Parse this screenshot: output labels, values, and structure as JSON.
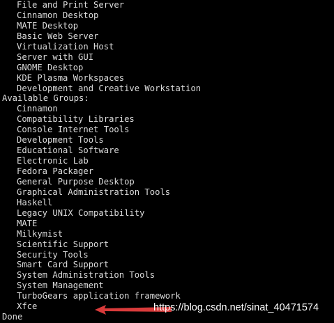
{
  "terminal": {
    "environment_groups_tail": [
      "File and Print Server",
      "Cinnamon Desktop",
      "MATE Desktop",
      "Basic Web Server",
      "Virtualization Host",
      "Server with GUI",
      "GNOME Desktop",
      "KDE Plasma Workspaces",
      "Development and Creative Workstation"
    ],
    "available_groups_header": "Available Groups:",
    "available_groups": [
      "Cinnamon",
      "Compatibility Libraries",
      "Console Internet Tools",
      "Development Tools",
      "Educational Software",
      "Electronic Lab",
      "Fedora Packager",
      "General Purpose Desktop",
      "Graphical Administration Tools",
      "Haskell",
      "Legacy UNIX Compatibility",
      "MATE",
      "Milkymist",
      "Scientific Support",
      "Security Tools",
      "Smart Card Support",
      "System Administration Tools",
      "System Management",
      "TurboGears application framework",
      "Xfce"
    ],
    "done_text": "Done",
    "text_color": "#dcdcdc",
    "background_color": "#000000"
  },
  "annotation": {
    "arrow_color": "#d93b3b",
    "arrow_icon": "left-arrow-icon"
  },
  "watermark": {
    "text": "https://blog.csdn.net/sinat_40471574"
  }
}
